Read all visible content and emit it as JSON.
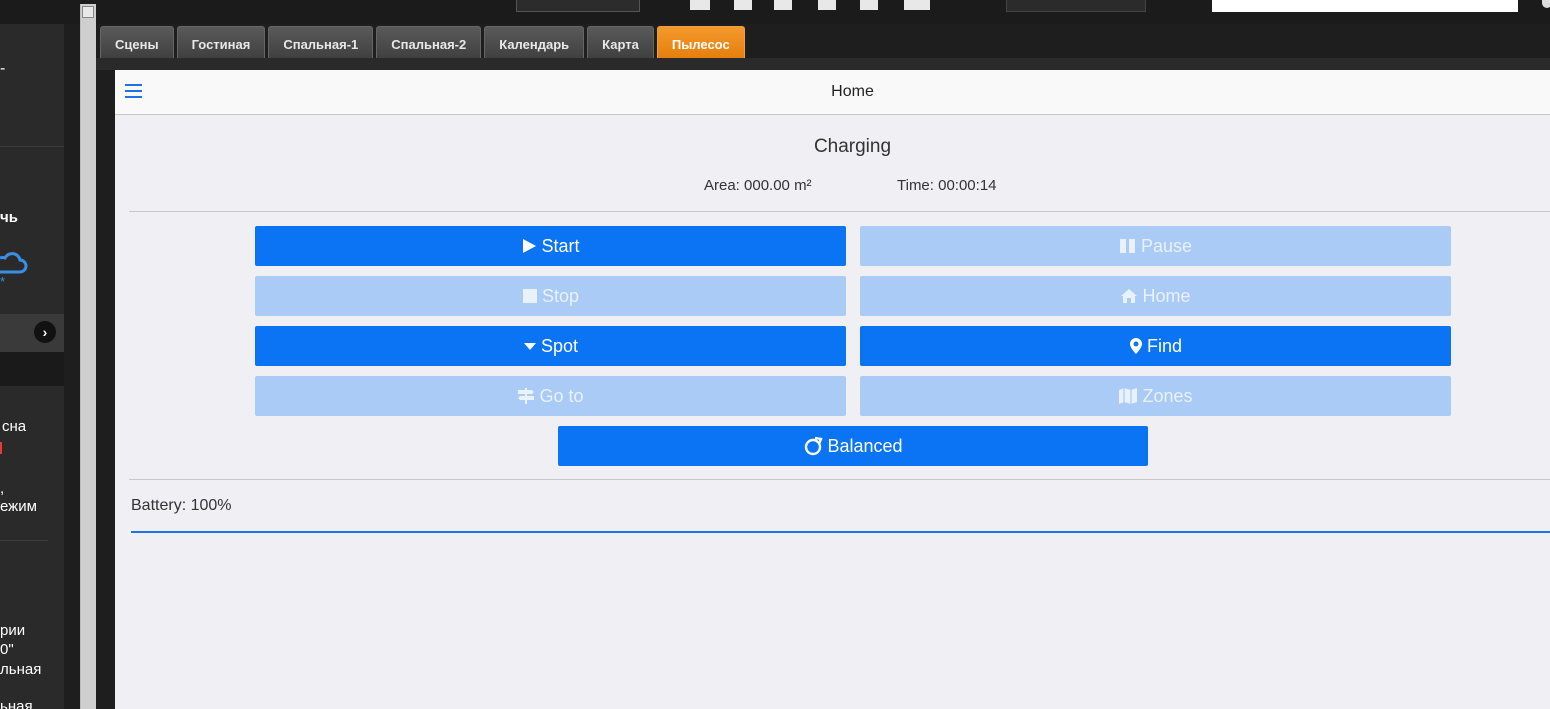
{
  "tabs": [
    {
      "label": "Сцены",
      "active": false
    },
    {
      "label": "Гостиная",
      "active": false
    },
    {
      "label": "Спальная-1",
      "active": false
    },
    {
      "label": "Спальная-2",
      "active": false
    },
    {
      "label": "Календарь",
      "active": false
    },
    {
      "label": "Карта",
      "active": false
    },
    {
      "label": "Пылесос",
      "active": true
    }
  ],
  "header": {
    "title": "Home",
    "menu_icon": "hamburger-icon"
  },
  "vacuum": {
    "status": "Charging",
    "area": "Area: 000.00 m²",
    "time": "Time: 00:00:14",
    "battery": "Battery: 100%",
    "battery_level": 100
  },
  "buttons": {
    "start": {
      "label": "Start",
      "enabled": true,
      "icon": "play-icon"
    },
    "pause": {
      "label": "Pause",
      "enabled": false,
      "icon": "pause-icon"
    },
    "stop": {
      "label": "Stop",
      "enabled": false,
      "icon": "stop-icon"
    },
    "home": {
      "label": "Home",
      "enabled": false,
      "icon": "home-icon"
    },
    "spot": {
      "label": "Spot",
      "enabled": true,
      "icon": "caret-down-icon"
    },
    "find": {
      "label": "Find",
      "enabled": true,
      "icon": "map-marker-icon"
    },
    "goto": {
      "label": "Go to",
      "enabled": false,
      "icon": "signpost-icon"
    },
    "zones": {
      "label": "Zones",
      "enabled": false,
      "icon": "map-icon"
    },
    "fan": {
      "label": "Balanced",
      "enabled": true,
      "icon": "fan-speed-icon"
    }
  },
  "left_panel": {
    "text1": "-",
    "text2": "чь",
    "text3": "сна",
    "text4": ",",
    "text5": "ежим",
    "text6": "рии",
    "text7": "0\"",
    "text8": "льная",
    "text9": "ьная"
  },
  "colors": {
    "accent": "#0a74f5",
    "disabled": "#a9cbf5",
    "active_tab": "#f0871a"
  }
}
